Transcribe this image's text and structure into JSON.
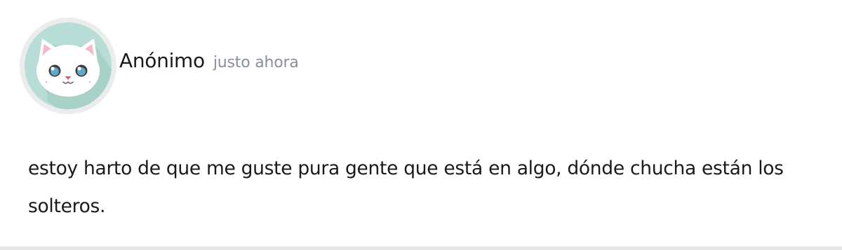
{
  "post": {
    "author": "Anónimo",
    "timestamp": "justo ahora",
    "text": "estoy harto de que me guste pura gente que está en algo, dónde chucha están los solteros.",
    "avatar_icon": "white-cat-avatar-icon"
  },
  "colors": {
    "avatar_bg": "#b7ddd6",
    "avatar_ring": "#ececec",
    "text": "#1a1a1a",
    "timestamp": "#8a8f96",
    "divider": "#e6e6e6"
  }
}
